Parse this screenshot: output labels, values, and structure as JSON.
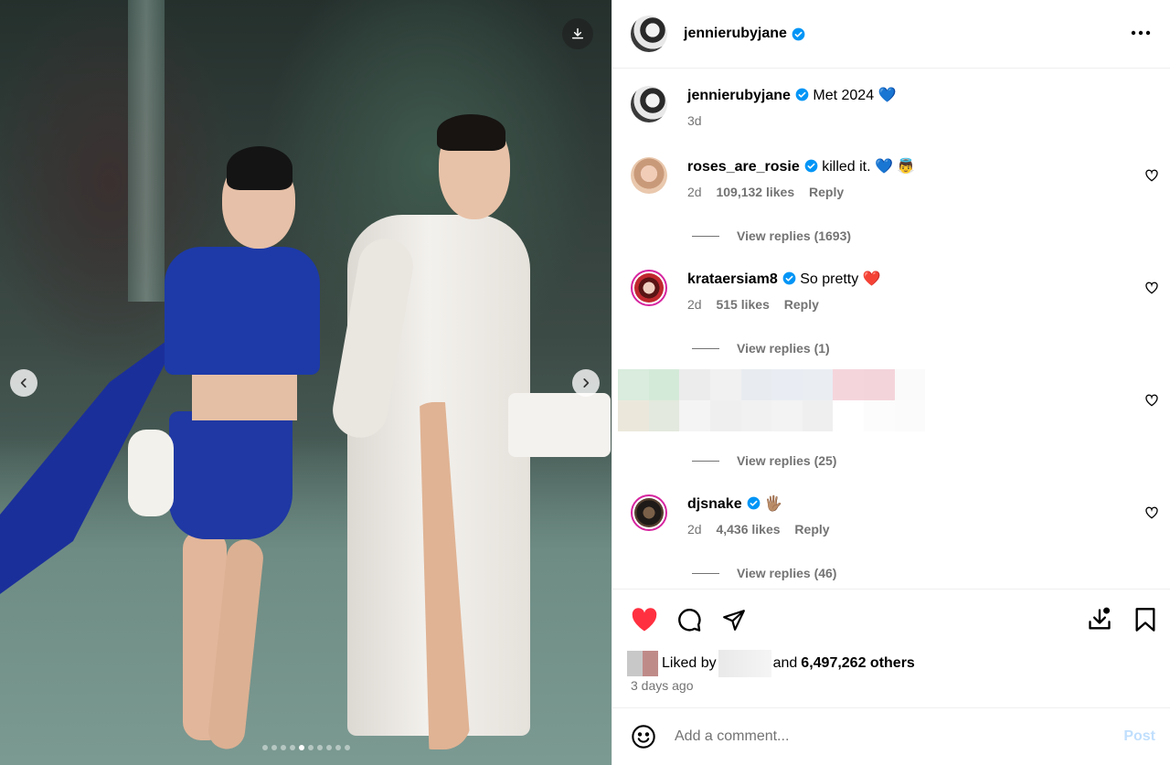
{
  "post": {
    "author": "jennierubyjane",
    "caption": "Met 2024",
    "caption_emoji": "💙",
    "posted_ago": "3d",
    "media": {
      "slide_count": 10,
      "active_slide": 4
    }
  },
  "comments": [
    {
      "username": "roses_are_rosie",
      "verified": true,
      "text": "killed it.",
      "emoji": "💙 👼",
      "age": "2d",
      "likes": "109,132 likes",
      "reply_label": "Reply",
      "view_replies": "View replies (1693)"
    },
    {
      "username": "krataersiam8",
      "verified": true,
      "text": "So pretty",
      "emoji": "❤️",
      "age": "2d",
      "likes": "515 likes",
      "reply_label": "Reply",
      "view_replies": "View replies (1)"
    },
    {
      "username": "",
      "text": "",
      "view_replies": "View replies (25)"
    },
    {
      "username": "djsnake",
      "verified": true,
      "text": "",
      "emoji": "🖐🏽",
      "age": "2d",
      "likes": "4,436 likes",
      "reply_label": "Reply",
      "view_replies": "View replies (46)"
    }
  ],
  "engagement": {
    "liked_prefix": "Liked by",
    "liked_suffix": "and",
    "others": "6,497,262 others",
    "time_ago": "3 days ago",
    "liked_by_user": true
  },
  "compose": {
    "placeholder": "Add a comment...",
    "post_label": "Post"
  },
  "colors": {
    "verified_blue": "#0095f6",
    "like_red": "#ff3040",
    "post_disabled": "#c0dffd",
    "ring_gradient": "#d6249f"
  },
  "icons": {
    "download": "download-icon",
    "prev": "chevron-left-icon",
    "next": "chevron-right-icon",
    "more": "more-horizontal-icon",
    "like": "heart-filled-icon",
    "comment": "comment-icon",
    "share": "send-icon",
    "save_to_collection": "download-tray-icon",
    "bookmark": "bookmark-icon",
    "emoji": "emoji-icon"
  }
}
